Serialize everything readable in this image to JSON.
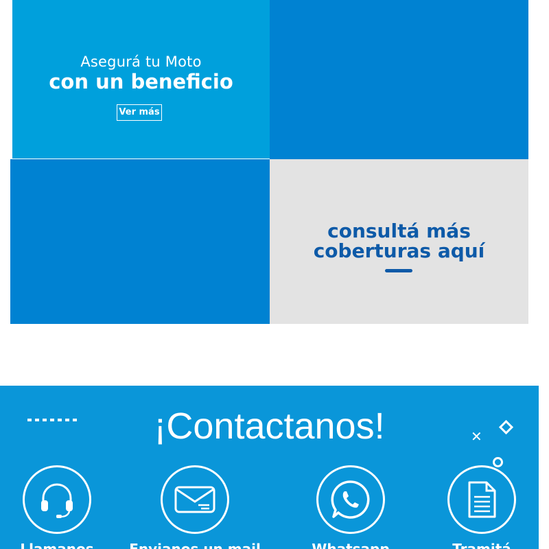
{
  "promo": {
    "line1": "Asegurá tu Moto",
    "line2": "con un beneficio",
    "button": "Ver más"
  },
  "coverage": {
    "link_text": "consultá más coberturas aquí"
  },
  "contact": {
    "title": "¡Contactanos!",
    "items": [
      {
        "icon": "headset-icon",
        "label": "Llamanos"
      },
      {
        "icon": "mail-icon",
        "label": "Envianos un mail"
      },
      {
        "icon": "whatsapp-icon",
        "label": "Whatsapp"
      },
      {
        "icon": "document-icon",
        "label": "Tramitá"
      }
    ]
  },
  "colors": {
    "promo_bg": "#00a0dc",
    "tile_blue": "#0082d2",
    "coverage_bg": "#e3e3e3",
    "coverage_text": "#0d5aa8",
    "contact_bg": "#0a96d9"
  }
}
